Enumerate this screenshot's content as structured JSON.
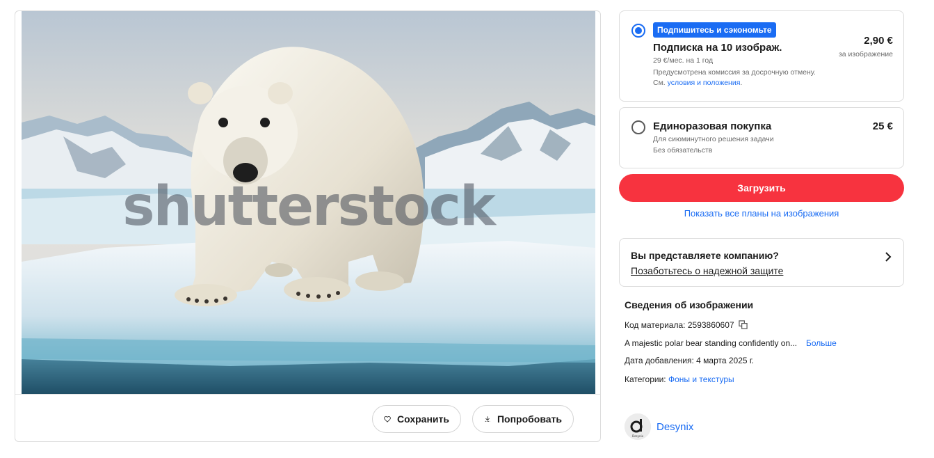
{
  "image": {
    "watermark": "shutterstock",
    "save_label": "Сохранить",
    "try_label": "Попробовать"
  },
  "plans": {
    "subscription": {
      "badge": "Подпишитесь и сэкономьте",
      "title": "Подписка на 10 изображ.",
      "note_price": "29 €/мес. на 1 год",
      "note_fee": "Предусмотрена комиссия за досрочную отмену.",
      "note_see": "См.",
      "note_terms_link": "условия и положения",
      "price": "2,90 €",
      "price_sub": "за изображение",
      "selected": true
    },
    "one_time": {
      "title": "Единоразовая покупка",
      "note_1": "Для сиюминутного решения задачи",
      "note_2": "Без обязательств",
      "price": "25 €",
      "selected": false
    },
    "download_label": "Загрузить",
    "all_plans_link": "Показать все планы на изображения"
  },
  "company": {
    "question": "Вы представляете компанию?",
    "link": "Позаботьтесь о надежной защите"
  },
  "info": {
    "title": "Сведения об изображении",
    "id_label": "Код материала:",
    "id_value": "2593860607",
    "description": "A majestic polar bear standing confidently on...",
    "more": "Больше",
    "date_label": "Дата добавления:",
    "date_value": "4 марта 2025 г.",
    "category_label": "Категории:",
    "category_value": "Фоны и текстуры"
  },
  "author": {
    "name": "Desynix",
    "avatar_text": "Desynix"
  },
  "colors": {
    "accent": "#1a6cf3",
    "download": "#f7333f"
  }
}
